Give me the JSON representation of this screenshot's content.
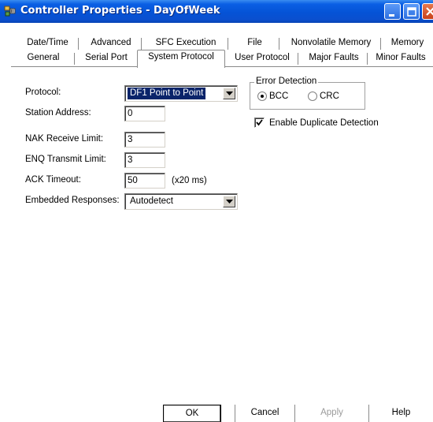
{
  "window": {
    "title": "Controller Properties - DayOfWeek",
    "icon": "controller-app-icon",
    "controls": [
      "minimize",
      "maximize",
      "close"
    ]
  },
  "tabs": {
    "row1": [
      "Date/Time",
      "Advanced",
      "SFC Execution",
      "File",
      "Nonvolatile Memory",
      "Memory"
    ],
    "row2": [
      "General",
      "Serial Port",
      "System Protocol",
      "User Protocol",
      "Major Faults",
      "Minor Faults"
    ],
    "active": "System Protocol"
  },
  "form": {
    "protocol_label": "Protocol:",
    "protocol_value": "DF1 Point to Point",
    "station_address_label": "Station Address:",
    "station_address_value": "0",
    "nak_label": "NAK Receive Limit:",
    "nak_value": "3",
    "enq_label": "ENQ Transmit Limit:",
    "enq_value": "3",
    "ack_label": "ACK Timeout:",
    "ack_value": "50",
    "ack_unit": "(x20 ms)",
    "embedded_label": "Embedded Responses:",
    "embedded_value": "Autodetect"
  },
  "error_detection": {
    "title": "Error Detection",
    "options": [
      "BCC",
      "CRC"
    ],
    "selected": "BCC"
  },
  "duplicate_detection": {
    "label": "Enable Duplicate Detection",
    "checked": true
  },
  "buttons": {
    "ok": "OK",
    "cancel": "Cancel",
    "apply": "Apply",
    "help": "Help"
  }
}
